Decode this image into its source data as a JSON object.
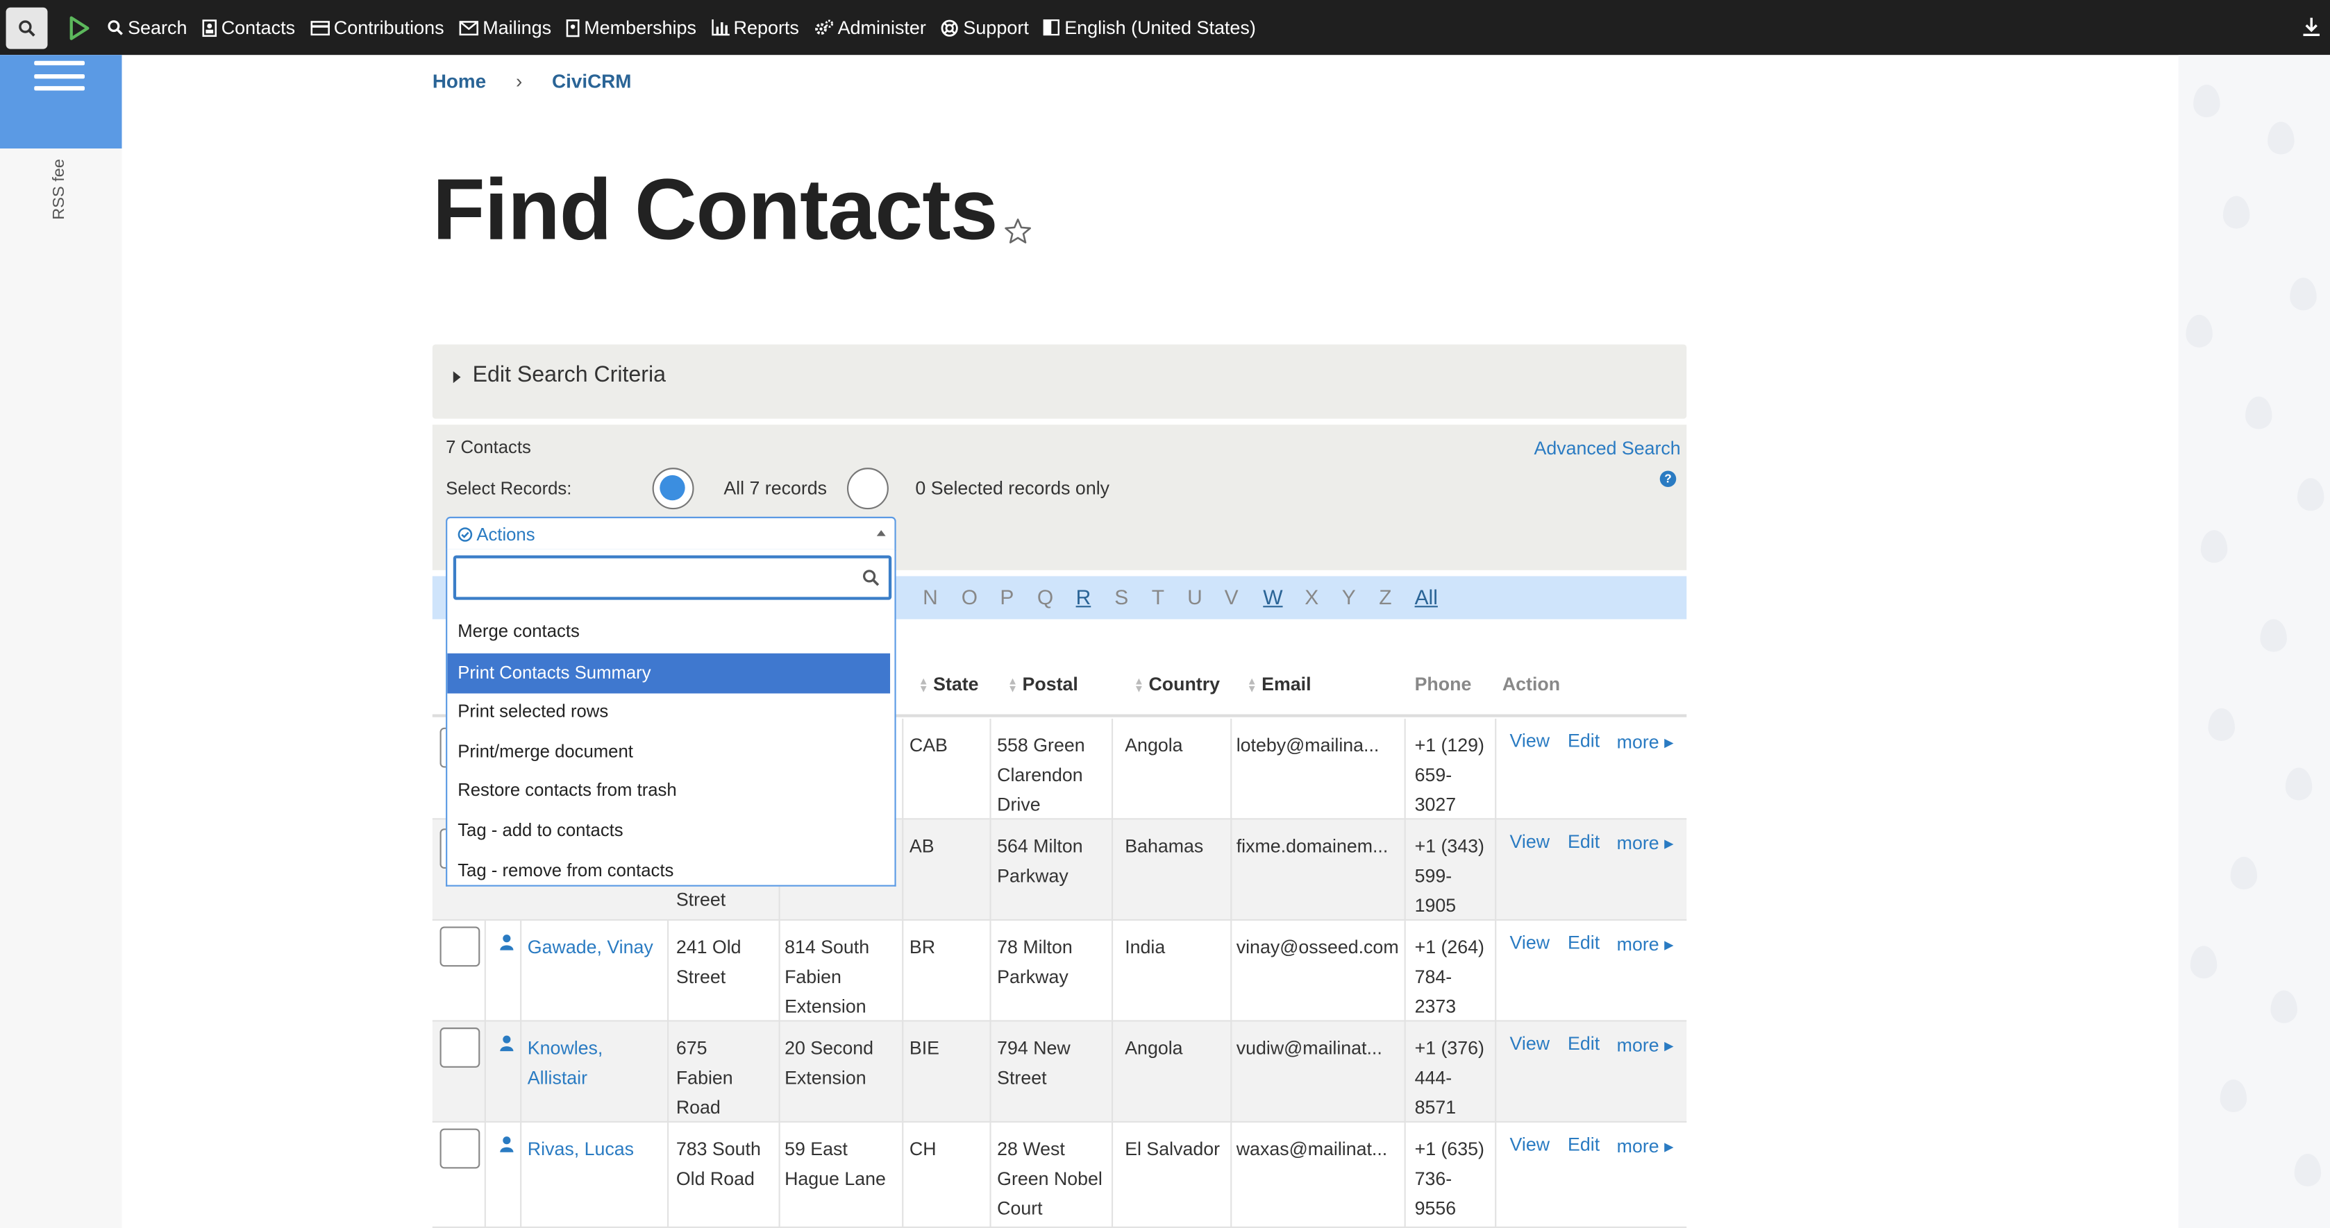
{
  "menubar": {
    "items": [
      "Search",
      "Contacts",
      "Contributions",
      "Mailings",
      "Memberships",
      "Reports",
      "Administer",
      "Support",
      "English (United States)"
    ]
  },
  "sidebar": {
    "rss_label": "RSS fee"
  },
  "breadcrumb": {
    "home": "Home",
    "separator": "›",
    "current": "CiviCRM"
  },
  "page": {
    "title": "Find Contacts"
  },
  "criteria": {
    "label": "Edit Search Criteria"
  },
  "results": {
    "count": "7 Contacts",
    "advanced_search": "Advanced Search",
    "help": "?",
    "select_records_label": "Select Records:",
    "all_records_label": "All 7 records",
    "selected_only_label": "0 Selected records only",
    "selected_option": "all"
  },
  "alphabet": {
    "visible": [
      "N",
      "O",
      "P",
      "Q",
      "R",
      "S",
      "T",
      "U",
      "V",
      "W",
      "X",
      "Y",
      "Z",
      "All"
    ],
    "active": [
      "R",
      "W",
      "All"
    ]
  },
  "table": {
    "headers": {
      "state": "State",
      "postal": "Postal",
      "country": "Country",
      "email": "Email",
      "phone": "Phone",
      "action": "Action"
    },
    "rows": [
      {
        "name": "",
        "addr1": "",
        "addr2": "",
        "state": "CAB",
        "postal": "558 Green Clarendon Drive",
        "country": "Angola",
        "email": "loteby@mailina...",
        "phone": "+1 (129) 659-3027"
      },
      {
        "name": "",
        "addr1": "Street",
        "addr2": "",
        "state": "AB",
        "postal": "564 Milton Parkway",
        "country": "Bahamas",
        "email": "fixme.domainem...",
        "phone": "+1 (343) 599-1905"
      },
      {
        "name": "Gawade, Vinay",
        "addr1": "241 Old Street",
        "addr2": "814 South Fabien Extension",
        "state": "BR",
        "postal": "78 Milton Parkway",
        "country": "India",
        "email": "vinay@osseed.com",
        "phone": "+1 (264) 784-2373"
      },
      {
        "name": "Knowles, Allistair",
        "addr1": "675 Fabien Road",
        "addr2": "20 Second Extension",
        "state": "BIE",
        "postal": "794 New Street",
        "country": "Angola",
        "email": "vudiw@mailinat...",
        "phone": "+1 (376) 444-8571"
      },
      {
        "name": "Rivas, Lucas",
        "addr1": "783 South Old Road",
        "addr2": "59 East Hague Lane",
        "state": "CH",
        "postal": "28 West Green Nobel Court",
        "country": "El Salvador",
        "email": "waxas@mailinat...",
        "phone": "+1 (635) 736-9556"
      }
    ],
    "actions": {
      "view": "View",
      "edit": "Edit",
      "more": "more"
    }
  },
  "actions_dropdown": {
    "label": "Actions",
    "search_value": "",
    "options": [
      "Merge contacts",
      "Print Contacts Summary",
      "Print selected rows",
      "Print/merge document",
      "Restore contacts from trash",
      "Tag - add to contacts",
      "Tag - remove from contacts"
    ],
    "highlighted": "Print Contacts Summary"
  },
  "colors": {
    "accent": "#2a7bc2",
    "highlight": "#3f78cf",
    "menubar": "#1f1f1f",
    "sidebar_blue": "#5b9ae4",
    "alpha_bar": "#cfe4fb"
  }
}
